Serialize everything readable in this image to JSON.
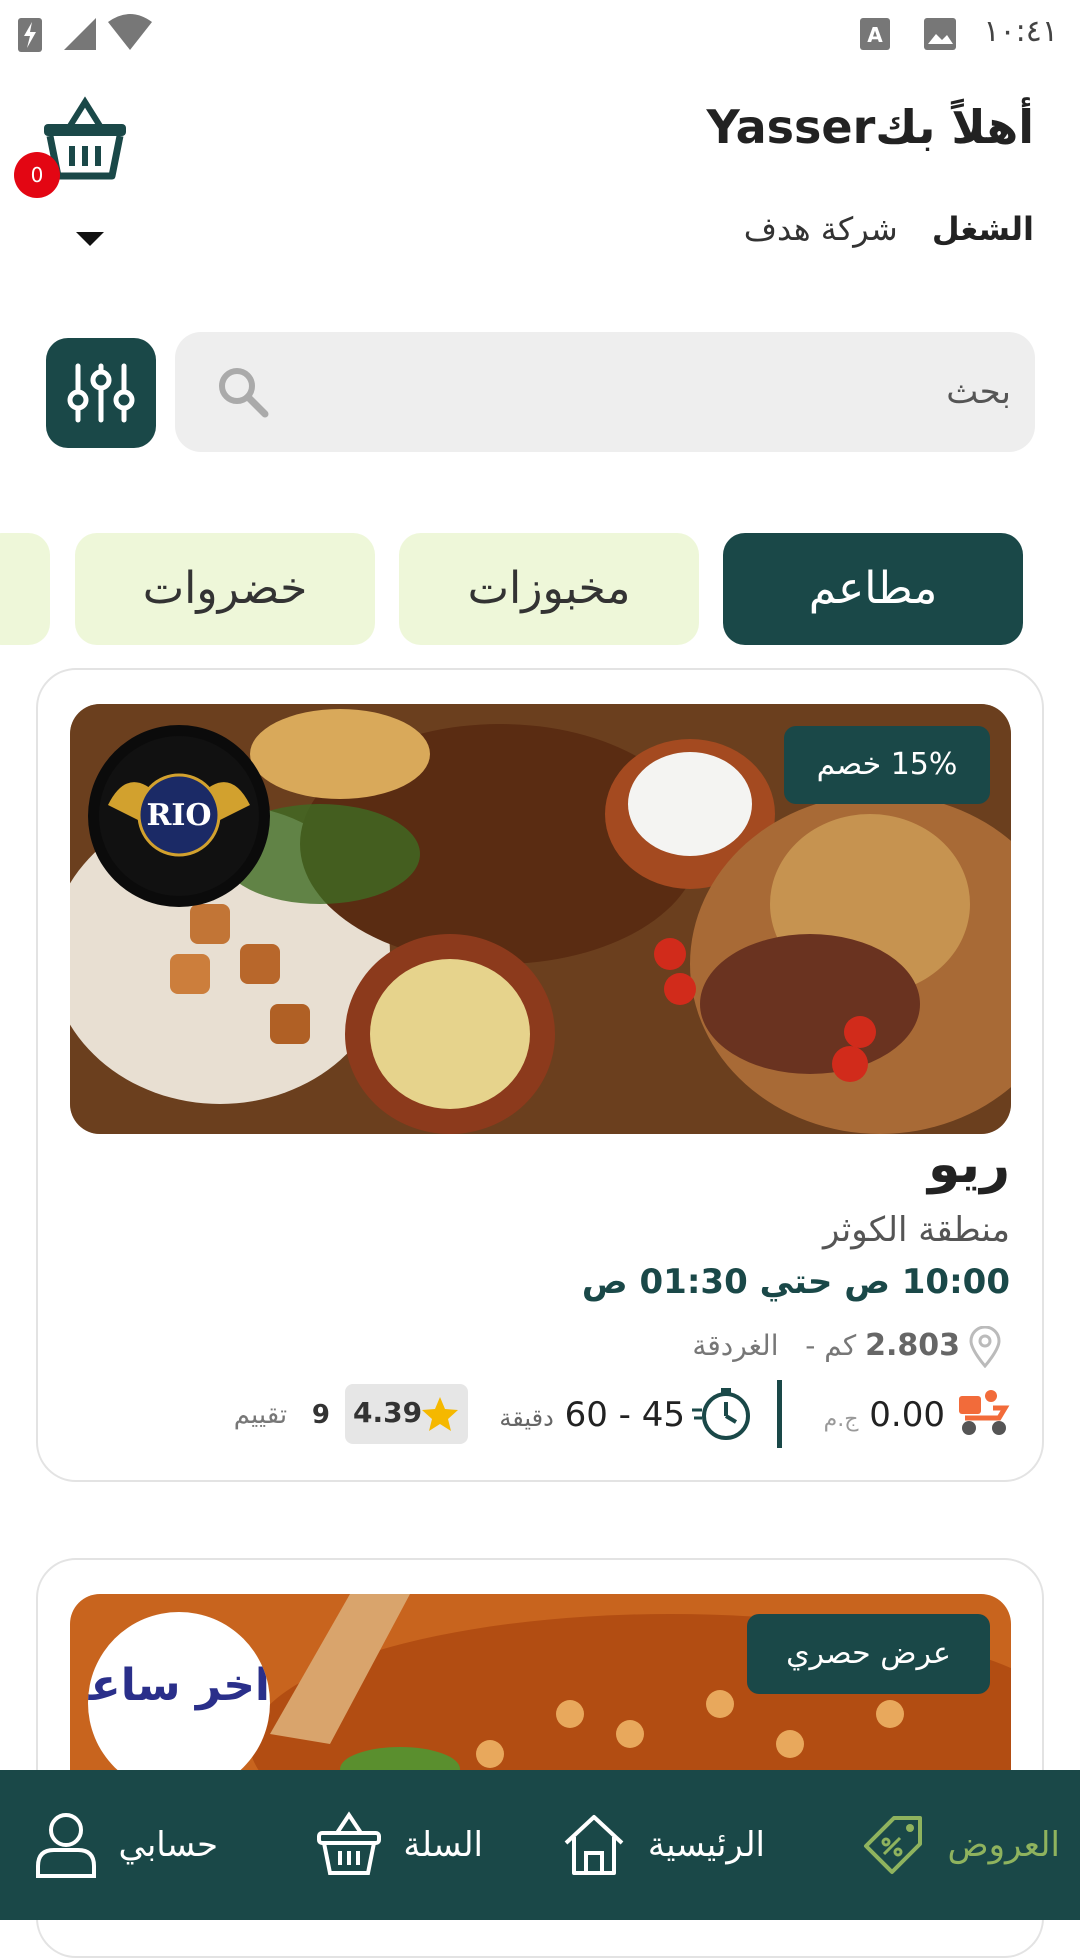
{
  "status_bar": {
    "time": "١٠:٤١"
  },
  "header": {
    "greeting": "أهلاً بكYasser",
    "company_label": "الشغل",
    "company_name": "شركة هدف",
    "cart_count": "0"
  },
  "search": {
    "placeholder": "بحث"
  },
  "categories": [
    {
      "label": "مطاعم",
      "active": true
    },
    {
      "label": "مخبوزات",
      "active": false
    },
    {
      "label": "خضروات",
      "active": false
    }
  ],
  "restaurants": [
    {
      "discount": "15% خصم",
      "name": "ريو",
      "area": "منطقة الكوثر",
      "hours": "10:00 ص  حتي 01:30 ص",
      "distance_value": "2.803",
      "distance_unit": "كم",
      "separator": "-",
      "city": "الغردقة",
      "delivery_fee": "0.00",
      "currency": "ج.م",
      "delivery_time": "45 - 60",
      "time_unit": "دقيقة",
      "rating": "4.39",
      "reviews_count": "9",
      "reviews_label": "تقييم",
      "logo_text": "RIO"
    },
    {
      "discount": "عرض حصري",
      "logo_text": "اخر ساعه"
    }
  ],
  "bottom_nav": [
    {
      "label": "العروض",
      "icon": "offers-tag-icon",
      "active": true
    },
    {
      "label": "الرئيسية",
      "icon": "home-icon",
      "active": false
    },
    {
      "label": "السلة",
      "icon": "basket-icon",
      "active": false
    },
    {
      "label": "حسابي",
      "icon": "user-icon",
      "active": false
    }
  ],
  "colors": {
    "primary": "#1a4848",
    "accent_green": "#8fb35e",
    "chip_bg": "#eef7d9",
    "badge_red": "#e30613",
    "star": "#f5b800"
  }
}
